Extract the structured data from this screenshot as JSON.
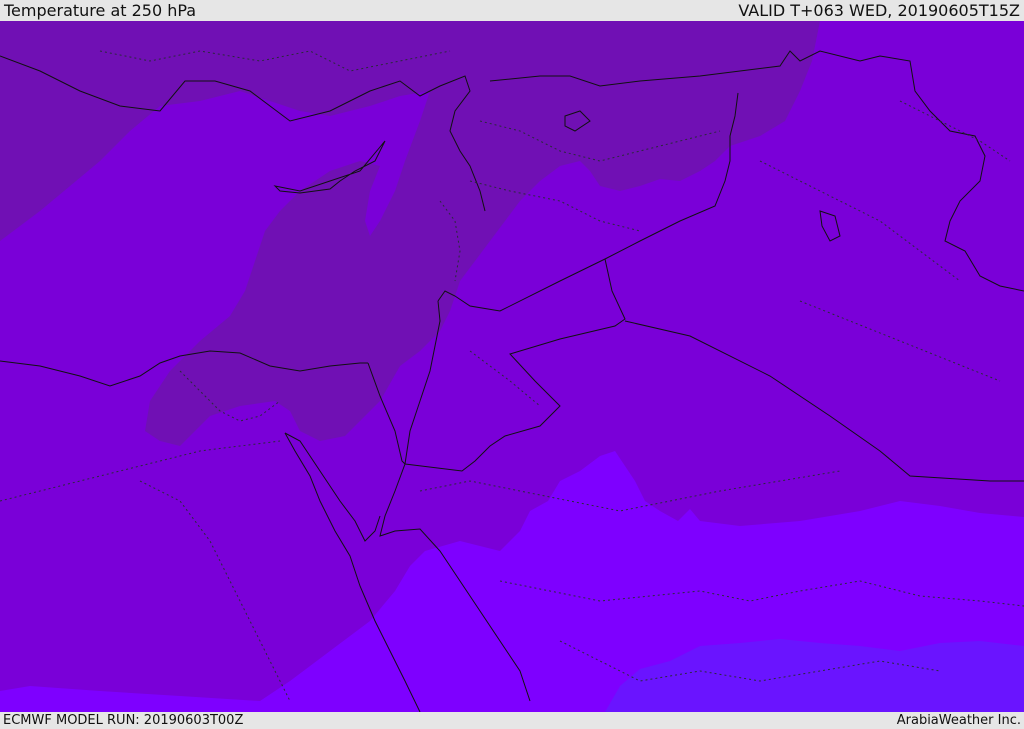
{
  "header": {
    "title": "Temperature at 250 hPa",
    "valid_time": "VALID T+063 WED, 20190605T15Z"
  },
  "footer": {
    "model_run": "ECMWF MODEL RUN: 20190603T00Z",
    "credit": "ArabiaWeather Inc."
  },
  "map": {
    "colors": {
      "warm_band": "#7010b4",
      "mid_band": "#7a00d8",
      "cool_band": "#7e00ff",
      "coldest_band": "#6a14ff",
      "border": "#111111",
      "admin_border": "#2a2a3a"
    }
  }
}
